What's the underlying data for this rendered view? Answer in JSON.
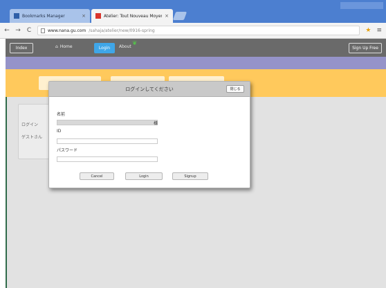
{
  "browser": {
    "tabs": [
      {
        "label": "Bookmarks Manager",
        "active": false
      },
      {
        "label": "Atelier: Tout Nouveau Moyen",
        "active": true
      }
    ],
    "tab_close_glyph": "×",
    "url_host": "www.nana.gu.com",
    "url_path": "/sahaja/atelier/new/0916-spring",
    "nav": {
      "back": "←",
      "forward": "→",
      "reload": "C"
    }
  },
  "appbar": {
    "brand_label": "Index",
    "home_label": "Home",
    "active_label": "Login",
    "extra_label": "About",
    "logout_label": "Sign Up Free"
  },
  "side_panel": {
    "line1": "ログイン",
    "line2": "ゲストさん"
  },
  "dialog": {
    "title": "ログインしてください",
    "close_label": "閉じる",
    "fields": [
      {
        "label": "名前",
        "value": "",
        "suffix": "様"
      },
      {
        "label": "ID",
        "value": ""
      },
      {
        "label": "パスワード",
        "value": ""
      }
    ],
    "buttons": [
      "Cancel",
      "Login",
      "Signup"
    ]
  },
  "colors": {
    "tabstrip": "#4c7fd0",
    "appbar": "#6a6a6a",
    "active_nav": "#3fa6e8",
    "purple_band": "#9593c9",
    "orange_band": "#ffc95c",
    "content_bg": "#e2e2e2"
  },
  "icons": {
    "home": "house-icon",
    "leaf": "leaf-icon",
    "star": "star-icon",
    "menu": "menu-icon"
  }
}
